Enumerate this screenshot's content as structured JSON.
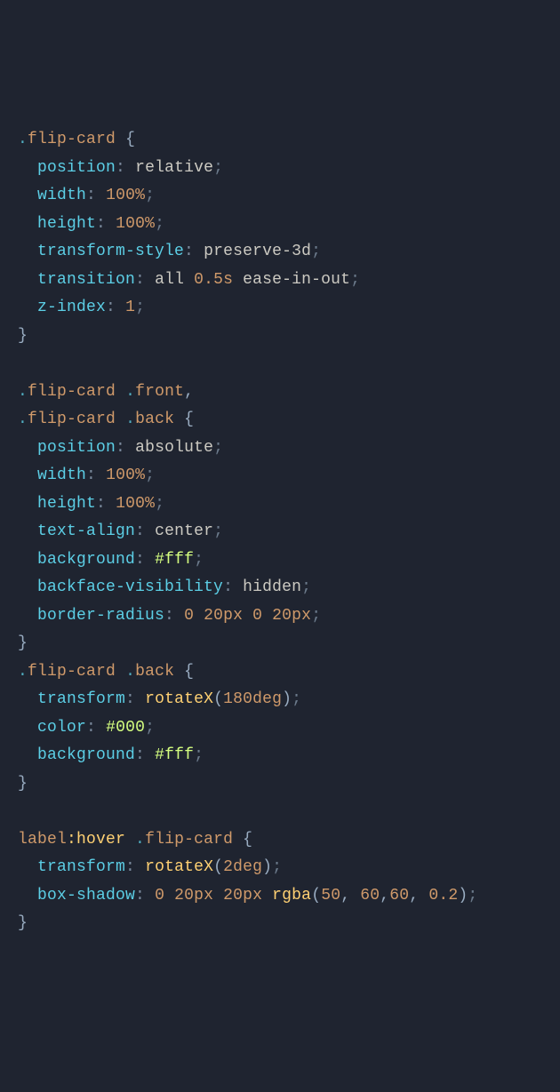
{
  "code": {
    "rules": [
      {
        "selector": ".flip-card",
        "declarations": [
          {
            "prop": "position",
            "value": "relative"
          },
          {
            "prop": "width",
            "value": "100%"
          },
          {
            "prop": "height",
            "value": "100%"
          },
          {
            "prop": "transform-style",
            "value": "preserve-3d"
          },
          {
            "prop": "transition",
            "value": "all 0.5s ease-in-out"
          },
          {
            "prop": "z-index",
            "value": "1"
          }
        ]
      },
      {
        "selector": ".flip-card .front,\n.flip-card .back",
        "declarations": [
          {
            "prop": "position",
            "value": "absolute"
          },
          {
            "prop": "width",
            "value": "100%"
          },
          {
            "prop": "height",
            "value": "100%"
          },
          {
            "prop": "text-align",
            "value": "center"
          },
          {
            "prop": "background",
            "value": "#fff"
          },
          {
            "prop": "backface-visibility",
            "value": "hidden"
          },
          {
            "prop": "border-radius",
            "value": "0 20px 0 20px"
          }
        ]
      },
      {
        "selector": ".flip-card .back",
        "declarations": [
          {
            "prop": "transform",
            "value": "rotateX(180deg)"
          },
          {
            "prop": "color",
            "value": "#000"
          },
          {
            "prop": "background",
            "value": "#fff"
          }
        ]
      },
      {
        "selector": "label:hover .flip-card",
        "declarations": [
          {
            "prop": "transform",
            "value": "rotateX(2deg)"
          },
          {
            "prop": "box-shadow",
            "value": "0 20px 20px rgba(50, 60,60, 0.2)"
          }
        ]
      }
    ]
  }
}
